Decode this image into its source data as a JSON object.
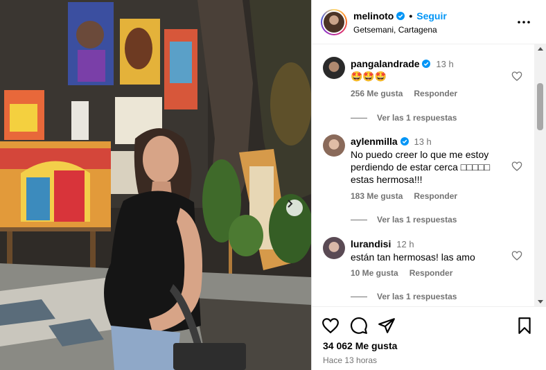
{
  "post": {
    "username": "melinoto",
    "follow_label": "Seguir",
    "separator": "•",
    "location": "Getsemani, Cartagena",
    "likes": "34 062 Me gusta",
    "time_ago": "Hace 13 horas"
  },
  "comments": [
    {
      "username": "pangalandrade",
      "verified": true,
      "time": "13 h",
      "text": "🤩🤩🤩",
      "likes": "256 Me gusta",
      "reply_label": "Responder",
      "replies": "Ver las 1 respuestas"
    },
    {
      "username": "aylenmilla",
      "verified": true,
      "time": "13 h",
      "text": "No puedo creer lo que me estoy perdiendo de estar cerca □□□□□ estas hermosa!!!",
      "likes": "183 Me gusta",
      "reply_label": "Responder",
      "replies": "Ver las 1 respuestas"
    },
    {
      "username": "lurandisi",
      "verified": false,
      "time": "12 h",
      "text": "están tan hermosas! las amo",
      "likes": "10 Me gusta",
      "reply_label": "Responder",
      "replies": "Ver las 1 respuestas"
    }
  ],
  "colors": {
    "accent": "#0095f6",
    "secondary_text": "#737373",
    "border": "#dbdbdb"
  },
  "icons": [
    "verified-icon",
    "more-options-icon",
    "heart-icon",
    "comment-icon",
    "share-icon",
    "bookmark-icon",
    "chevron-right-icon"
  ]
}
